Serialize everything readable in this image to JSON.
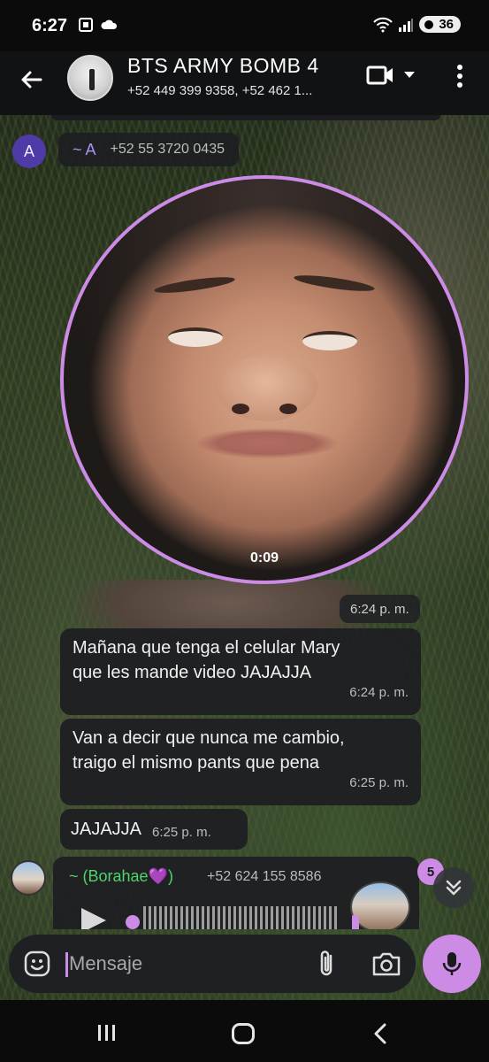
{
  "status_bar": {
    "time": "6:27",
    "battery": "36",
    "icons": [
      "screenshot-icon",
      "cloud-icon",
      "wifi-icon",
      "signal-icon",
      "battery-icon"
    ]
  },
  "header": {
    "title": "BTS ARMY BOMB 4",
    "subtitle": "+52 449 399 9358, +52 462 1...",
    "icons": [
      "back-arrow-icon",
      "video-call-icon",
      "dropdown-icon",
      "more-options-icon"
    ]
  },
  "chat": {
    "sender": {
      "avatar_letter": "A",
      "name": "~ A",
      "phone": "+52 55 3720 0435"
    },
    "video_note": {
      "duration": "0:09",
      "time": "6:24 p. m."
    },
    "messages": [
      {
        "text": "Mañana que tenga el celular Mary\nque les mande video JAJAJJA",
        "time": "6:24 p. m."
      },
      {
        "text": "Van a decir que nunca me cambio,\ntraigo el mismo pants que pena",
        "time": "6:25 p. m."
      },
      {
        "text": "JAJAJJA",
        "time": "6:25 p. m."
      }
    ],
    "voice_message": {
      "sender_name": "~ (Borahae💜)",
      "phone": "+52 624 155 8586"
    },
    "unread_count": "5"
  },
  "composer": {
    "placeholder": "Mensaje",
    "icons": [
      "emoji-icon",
      "attach-icon",
      "camera-icon",
      "microphone-icon"
    ]
  },
  "colors": {
    "accent": "#cc8ce6",
    "sender_name": "#a995f5",
    "voice_sender_name": "#4fd46b",
    "bubble_bg": "#1e1f22",
    "header_bg": "#111213"
  }
}
